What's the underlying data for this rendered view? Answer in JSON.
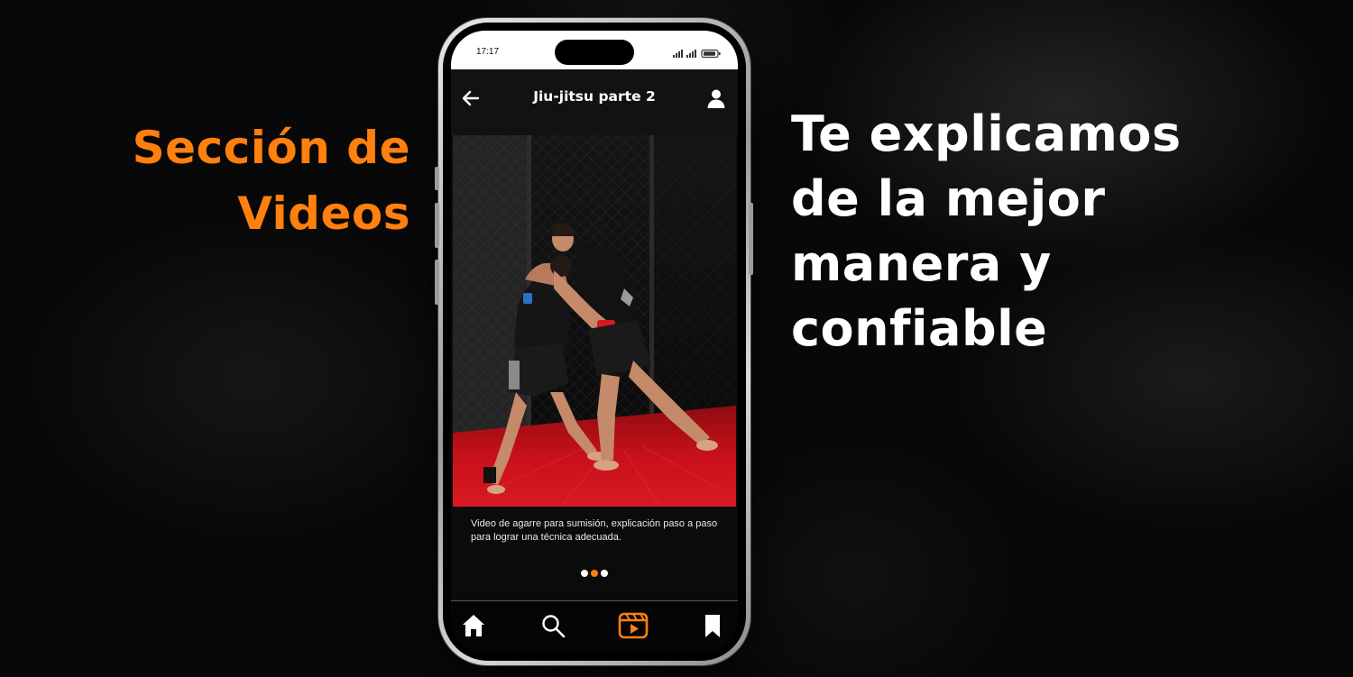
{
  "promo": {
    "left_heading": [
      "Sección de",
      "Videos"
    ],
    "right_heading": [
      "Te explicamos",
      "de la mejor",
      "manera y",
      "confiable"
    ]
  },
  "status_bar": {
    "time": "17:17"
  },
  "app": {
    "title": "Jiu-jitsu parte 2",
    "video_caption": "Video de agarre para sumisión, explicación paso a paso para lograr una técnica adecuada.",
    "carousel": {
      "total": 3,
      "active_index": 1
    },
    "bottom_nav": [
      {
        "name": "home",
        "icon": "home-icon"
      },
      {
        "name": "search",
        "icon": "search-icon"
      },
      {
        "name": "videos",
        "icon": "video-icon",
        "active": true
      },
      {
        "name": "saved",
        "icon": "bookmark-icon"
      }
    ]
  },
  "colors": {
    "accent": "#ff7f0f",
    "background": "#080808",
    "mat_red": "#c8101a"
  }
}
